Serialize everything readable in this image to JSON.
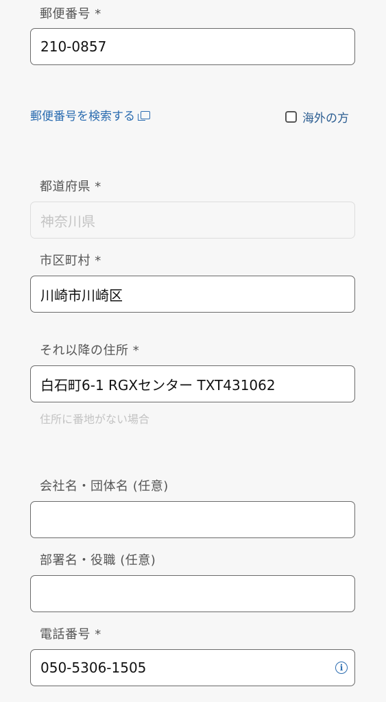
{
  "postal": {
    "label": "郵便番号 *",
    "value": "210-0857",
    "search_link": "郵便番号を検索する",
    "overseas_label": "海外の方",
    "overseas_checked": false
  },
  "prefecture": {
    "label": "都道府県 *",
    "value": "神奈川県"
  },
  "city": {
    "label": "市区町村 *",
    "value": "川崎市川崎区"
  },
  "address": {
    "label": "それ以降の住所 *",
    "value": "白石町6-1 RGXセンター TXT431062",
    "hint": "住所に番地がない場合"
  },
  "company": {
    "label": "会社名・団体名 (任意)",
    "value": ""
  },
  "department": {
    "label": "部署名・役職 (任意)",
    "value": ""
  },
  "phone": {
    "label": "電話番号 *",
    "value": "050-5306-1505",
    "info_icon": "info-icon"
  }
}
